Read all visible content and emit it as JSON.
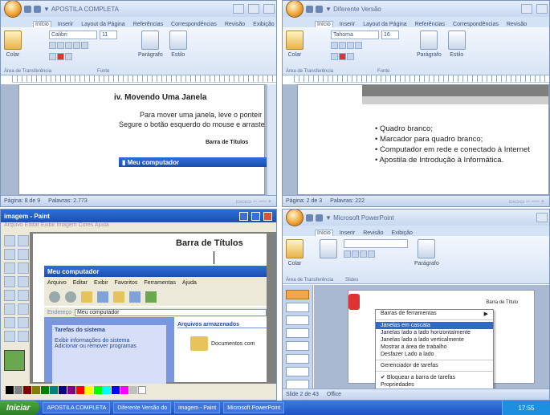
{
  "word_left": {
    "heading": "iv.  Movendo Uma Janela",
    "body_line1": "Para mover uma janela, leve o ponteir",
    "body_line2": "Segure o botão esquerdo do mouse e arraste",
    "caption": "Barra de Títulos",
    "status_page": "Página: 8 de 9",
    "status_words": "Palavras: 2.773",
    "font_name": "Calibri",
    "font_size": "11",
    "group_clipboard": "Área de Transferência",
    "group_font": "Fonte",
    "group_paragraph": "Parágrafo",
    "group_style": "Estilo",
    "tab_home": "Início",
    "tab_insert": "Inserir",
    "tab_layout": "Layout da Página",
    "tab_refs": "Referências",
    "tab_mail": "Correspondências",
    "tab_review": "Revisão",
    "tab_view": "Exibição",
    "paste_label": "Colar"
  },
  "word_right": {
    "bullets": [
      "Quadro branco;",
      "Marcador para quadro branco;",
      "Computador em rede e conectado à Internet",
      "Apostila de Introdução à Informática."
    ],
    "status_page": "Página: 2 de 3",
    "status_words": "Palavras: 222",
    "font_name": "Tahoma",
    "font_size": "16",
    "group_clipboard": "Área de Transferência",
    "group_font": "Fonte",
    "group_paragraph": "Parágrafo",
    "group_style": "Estilo",
    "paste_label": "Colar"
  },
  "paint": {
    "title": "imagem - Paint",
    "caption": "Barra de Títulos",
    "window_title": "Meu computador",
    "menu": [
      "Arquivo",
      "Editar",
      "Exibir",
      "Favoritos",
      "Ferramentas",
      "Ajuda"
    ],
    "address_label": "Endereço",
    "address_value": "Meu computador",
    "tasks_title": "Tarefas do sistema",
    "task1": "Exibir informações do sistema",
    "task2": "Adicionar ou remover programas",
    "files_title": "Arquivos armazenados",
    "shared_docs": "Documentos com"
  },
  "ppt": {
    "group_clipboard": "Área de Transferência",
    "group_slides": "Slides",
    "group_paragraph": "Parágrafo",
    "slide_count": "Slide 2 de 43",
    "theme": "Office",
    "title_bar_label": "Barra de Título",
    "paste_label": "Colar",
    "context_menu": [
      {
        "label": "Barras de ferramentas",
        "arrow": "▶"
      },
      {
        "label": "Janelas em cascata"
      },
      {
        "label": "Janelas lado a lado horizontalmente"
      },
      {
        "label": "Janelas lado a lado verticalmente"
      },
      {
        "label": "Mostrar a área de trabalho"
      },
      {
        "label": "Desfazer Lado a lado"
      },
      {
        "label": "Gerenciador de tarefas"
      },
      {
        "label": "Bloquear a barra de tarefas"
      },
      {
        "label": "Propriedades"
      }
    ]
  },
  "taskbar": {
    "start": "Iniciar",
    "items": [
      "APOSTILA COMPLETA",
      "Diferente Versão do",
      "imagem - Paint",
      "Microsoft PowerPoint"
    ],
    "clock": "17:55"
  },
  "colors": {
    "ribbon_blue": "#d5e3f6",
    "xp_blue": "#2e6fd8",
    "selection": "#316ac5"
  }
}
